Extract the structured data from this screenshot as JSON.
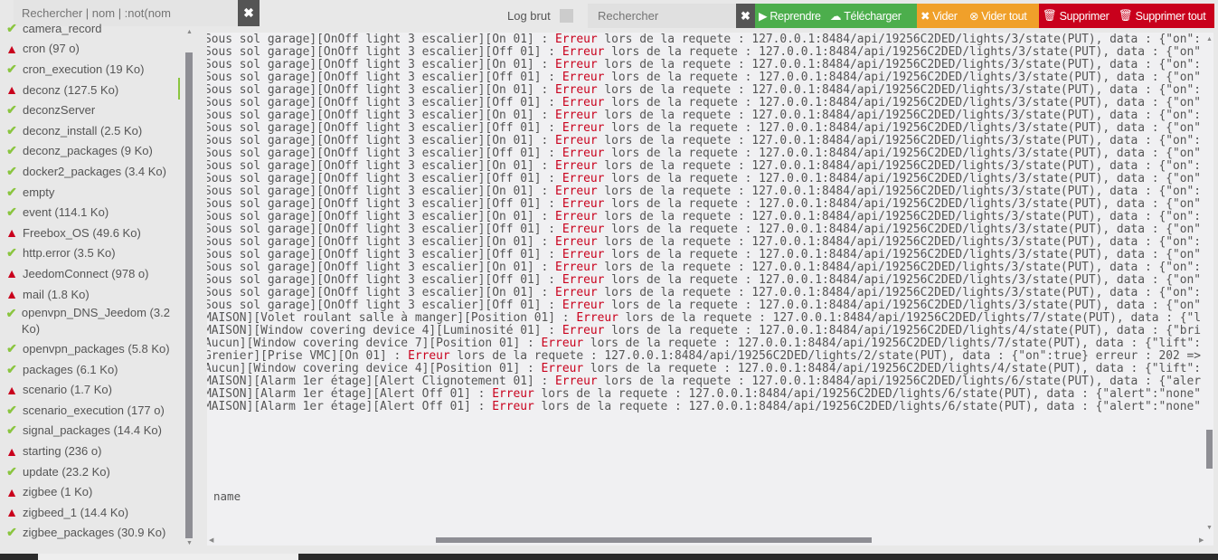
{
  "sidebar": {
    "search_placeholder": "Rechercher | nom | :not(nom",
    "clear": "✖",
    "items": [
      {
        "label": "camera_record",
        "status": "ok"
      },
      {
        "label": "cron (97 o)",
        "status": "warn"
      },
      {
        "label": "cron_execution (19 Ko)",
        "status": "ok"
      },
      {
        "label": "deconz (127.5 Ko)",
        "status": "warn",
        "active": true
      },
      {
        "label": "deconzServer",
        "status": "ok"
      },
      {
        "label": "deconz_install (2.5 Ko)",
        "status": "ok"
      },
      {
        "label": "deconz_packages (9 Ko)",
        "status": "ok"
      },
      {
        "label": "docker2_packages (3.4 Ko)",
        "status": "ok"
      },
      {
        "label": "empty",
        "status": "ok"
      },
      {
        "label": "event (114.1 Ko)",
        "status": "ok"
      },
      {
        "label": "Freebox_OS (49.6 Ko)",
        "status": "warn"
      },
      {
        "label": "http.error (3.5 Ko)",
        "status": "ok"
      },
      {
        "label": "JeedomConnect (978 o)",
        "status": "warn"
      },
      {
        "label": "mail (1.8 Ko)",
        "status": "warn"
      },
      {
        "label": "openvpn_DNS_Jeedom (3.2 Ko)",
        "status": "ok"
      },
      {
        "label": "openvpn_packages (5.8 Ko)",
        "status": "ok"
      },
      {
        "label": "packages (6.1 Ko)",
        "status": "ok"
      },
      {
        "label": "scenario (1.7 Ko)",
        "status": "warn"
      },
      {
        "label": "scenario_execution (177 o)",
        "status": "ok"
      },
      {
        "label": "signal_packages (14.4 Ko)",
        "status": "ok"
      },
      {
        "label": "starting (236 o)",
        "status": "warn"
      },
      {
        "label": "update (23.2 Ko)",
        "status": "ok"
      },
      {
        "label": "zigbee (1 Ko)",
        "status": "warn"
      },
      {
        "label": "zigbeed_1 (14.4 Ko)",
        "status": "warn"
      },
      {
        "label": "zigbee_packages (30.9 Ko)",
        "status": "ok"
      }
    ]
  },
  "toolbar": {
    "log_brut": "Log brut",
    "search_placeholder": "Rechercher",
    "clear": "✖",
    "reprendre": "Reprendre",
    "telecharger": "Télécharger",
    "vider": "Vider",
    "vider_tout": "Vider tout",
    "supprimer": "Supprimer",
    "supprimer_tout": "Supprimer tout",
    "colors": {
      "green": "#4cae4c",
      "orange": "#f0a02a",
      "red": "#c9001c"
    }
  },
  "log": {
    "error_word": "Erreur",
    "lines": [
      [
        "Sous sol garage][OnOff light 3 escalier][On 01] : ",
        "lors de la requete : 127.0.0.1:8484/api/19256C2DED/lights/3/state(PUT), data : {\"on\":"
      ],
      [
        "Sous sol garage][OnOff light 3 escalier][Off 01] : ",
        "lors de la requete : 127.0.0.1:8484/api/19256C2DED/lights/3/state(PUT), data : {\"on\""
      ],
      [
        "Sous sol garage][OnOff light 3 escalier][On 01] : ",
        "lors de la requete : 127.0.0.1:8484/api/19256C2DED/lights/3/state(PUT), data : {\"on\":"
      ],
      [
        "Sous sol garage][OnOff light 3 escalier][Off 01] : ",
        "lors de la requete : 127.0.0.1:8484/api/19256C2DED/lights/3/state(PUT), data : {\"on\""
      ],
      [
        "Sous sol garage][OnOff light 3 escalier][On 01] : ",
        "lors de la requete : 127.0.0.1:8484/api/19256C2DED/lights/3/state(PUT), data : {\"on\":"
      ],
      [
        "Sous sol garage][OnOff light 3 escalier][Off 01] : ",
        "lors de la requete : 127.0.0.1:8484/api/19256C2DED/lights/3/state(PUT), data : {\"on\""
      ],
      [
        "Sous sol garage][OnOff light 3 escalier][On 01] : ",
        "lors de la requete : 127.0.0.1:8484/api/19256C2DED/lights/3/state(PUT), data : {\"on\":"
      ],
      [
        "Sous sol garage][OnOff light 3 escalier][Off 01] : ",
        "lors de la requete : 127.0.0.1:8484/api/19256C2DED/lights/3/state(PUT), data : {\"on\""
      ],
      [
        "Sous sol garage][OnOff light 3 escalier][On 01] : ",
        "lors de la requete : 127.0.0.1:8484/api/19256C2DED/lights/3/state(PUT), data : {\"on\":"
      ],
      [
        "Sous sol garage][OnOff light 3 escalier][Off 01] : ",
        "lors de la requete : 127.0.0.1:8484/api/19256C2DED/lights/3/state(PUT), data : {\"on\""
      ],
      [
        "Sous sol garage][OnOff light 3 escalier][On 01] : ",
        "lors de la requete : 127.0.0.1:8484/api/19256C2DED/lights/3/state(PUT), data : {\"on\":"
      ],
      [
        "Sous sol garage][OnOff light 3 escalier][Off 01] : ",
        "lors de la requete : 127.0.0.1:8484/api/19256C2DED/lights/3/state(PUT), data : {\"on\""
      ],
      [
        "Sous sol garage][OnOff light 3 escalier][On 01] : ",
        "lors de la requete : 127.0.0.1:8484/api/19256C2DED/lights/3/state(PUT), data : {\"on\":"
      ],
      [
        "Sous sol garage][OnOff light 3 escalier][Off 01] : ",
        "lors de la requete : 127.0.0.1:8484/api/19256C2DED/lights/3/state(PUT), data : {\"on\""
      ],
      [
        "Sous sol garage][OnOff light 3 escalier][On 01] : ",
        "lors de la requete : 127.0.0.1:8484/api/19256C2DED/lights/3/state(PUT), data : {\"on\":"
      ],
      [
        "Sous sol garage][OnOff light 3 escalier][Off 01] : ",
        "lors de la requete : 127.0.0.1:8484/api/19256C2DED/lights/3/state(PUT), data : {\"on\""
      ],
      [
        "Sous sol garage][OnOff light 3 escalier][On 01] : ",
        "lors de la requete : 127.0.0.1:8484/api/19256C2DED/lights/3/state(PUT), data : {\"on\":"
      ],
      [
        "Sous sol garage][OnOff light 3 escalier][Off 01] : ",
        "lors de la requete : 127.0.0.1:8484/api/19256C2DED/lights/3/state(PUT), data : {\"on\""
      ],
      [
        "Sous sol garage][OnOff light 3 escalier][On 01] : ",
        "lors de la requete : 127.0.0.1:8484/api/19256C2DED/lights/3/state(PUT), data : {\"on\":"
      ],
      [
        "Sous sol garage][OnOff light 3 escalier][Off 01] : ",
        "lors de la requete : 127.0.0.1:8484/api/19256C2DED/lights/3/state(PUT), data : {\"on\""
      ],
      [
        "Sous sol garage][OnOff light 3 escalier][On 01] : ",
        "lors de la requete : 127.0.0.1:8484/api/19256C2DED/lights/3/state(PUT), data : {\"on\":"
      ],
      [
        "Sous sol garage][OnOff light 3 escalier][Off 01] : ",
        "lors de la requete : 127.0.0.1:8484/api/19256C2DED/lights/3/state(PUT), data : {\"on\""
      ],
      [
        "MAISON][Volet roulant salle à manger][Position 01] : ",
        "lors de la requete : 127.0.0.1:8484/api/19256C2DED/lights/7/state(PUT), data : {\"l"
      ],
      [
        "MAISON][Window covering device 4][Luminosité 01] : ",
        "lors de la requete : 127.0.0.1:8484/api/19256C2DED/lights/4/state(PUT), data : {\"bri"
      ],
      [
        "Aucun][Window covering device 7][Position 01] : ",
        "lors de la requete : 127.0.0.1:8484/api/19256C2DED/lights/7/state(PUT), data : {\"lift\":"
      ],
      [
        "Grenier][Prise VMC][On 01] : ",
        "lors de la requete : 127.0.0.1:8484/api/19256C2DED/lights/2/state(PUT), data : {\"on\":true} erreur : 202 =>"
      ],
      [
        "Aucun][Window covering device 4][Position 01] : ",
        "lors de la requete : 127.0.0.1:8484/api/19256C2DED/lights/4/state(PUT), data : {\"lift\":"
      ],
      [
        "MAISON][Alarm 1er étage][Alert Clignotement 01] : ",
        "lors de la requete : 127.0.0.1:8484/api/19256C2DED/lights/6/state(PUT), data : {\"aler"
      ],
      [
        "MAISON][Alarm 1er étage][Alert Off 01] : ",
        "lors de la requete : 127.0.0.1:8484/api/19256C2DED/lights/6/state(PUT), data : {\"alert\":\"none\""
      ],
      [
        "MAISON][Alarm 1er étage][Alert Off 01] : ",
        "lors de la requete : 127.0.0.1:8484/api/19256C2DED/lights/6/state(PUT), data : {\"alert\":\"none\""
      ]
    ],
    "footer_text": "name"
  }
}
